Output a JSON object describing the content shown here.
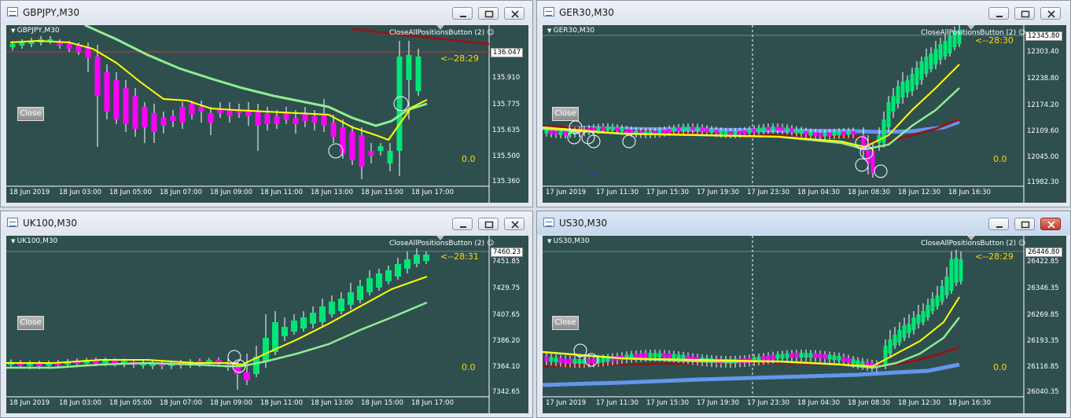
{
  "theme": {
    "bg": "#2f4f4f",
    "bull": "#00e676",
    "bear": "#ff00ff",
    "ma_fast": "#ffff00",
    "ma_mid": "#90ee90",
    "ma_slow": "#8b1a1a",
    "ma_long": "#6495ed",
    "timer": "#ffd700"
  },
  "common": {
    "close_label": "Close",
    "button_caption": "CloseAllPositionsButton (2)",
    "zero_value": "0.0"
  },
  "windows": [
    {
      "title": "GBPJPY,M30",
      "symbol_label": "GBPJPY,M30",
      "timer": "<--28:29",
      "price_box": "136.047",
      "price_scale": [
        "135.910",
        "135.775",
        "135.635",
        "135.500",
        "135.360"
      ],
      "time_scale": [
        "18 Jun 2019",
        "18 Jun 03:00",
        "18 Jun 05:00",
        "18 Jun 07:00",
        "18 Jun 09:00",
        "18 Jun 11:00",
        "18 Jun 13:00",
        "18 Jun 15:00",
        "18 Jun 17:00"
      ]
    },
    {
      "title": "GER30,M30",
      "symbol_label": "GER30,M30",
      "timer": "<--28:30",
      "price_box": "12345.80",
      "price_scale": [
        "12303.40",
        "12238.80",
        "12174.20",
        "12109.60",
        "12045.00",
        "11982.30"
      ],
      "time_scale": [
        "17 Jun 2019",
        "17 Jun 11:30",
        "17 Jun 15:30",
        "17 Jun 19:30",
        "17 Jun 23:30",
        "18 Jun 04:30",
        "18 Jun 08:30",
        "18 Jun 12:30",
        "18 Jun 16:30"
      ]
    },
    {
      "title": "UK100,M30",
      "symbol_label": "UK100,M30",
      "timer": "<--28:31",
      "price_box": "7460.23",
      "price_scale": [
        "7451.85",
        "7429.75",
        "7407.65",
        "7386.20",
        "7364.10",
        "7342.65"
      ],
      "time_scale": [
        "18 Jun 2019",
        "18 Jun 03:00",
        "18 Jun 05:00",
        "18 Jun 07:00",
        "18 Jun 09:00",
        "18 Jun 11:00",
        "18 Jun 13:00",
        "18 Jun 15:00",
        "18 Jun 17:00"
      ]
    },
    {
      "title": "US30,M30",
      "symbol_label": "US30,M30",
      "timer": "<--28:29",
      "price_box": "26446.80",
      "price_scale": [
        "26422.85",
        "26346.35",
        "26269.85",
        "26193.35",
        "26116.85",
        "26040.35"
      ],
      "time_scale": [
        "17 Jun 2019",
        "17 Jun 11:30",
        "17 Jun 15:30",
        "17 Jun 19:30",
        "17 Jun 23:30",
        "18 Jun 04:30",
        "18 Jun 08:30",
        "18 Jun 12:30",
        "18 Jun 16:30"
      ]
    }
  ]
}
